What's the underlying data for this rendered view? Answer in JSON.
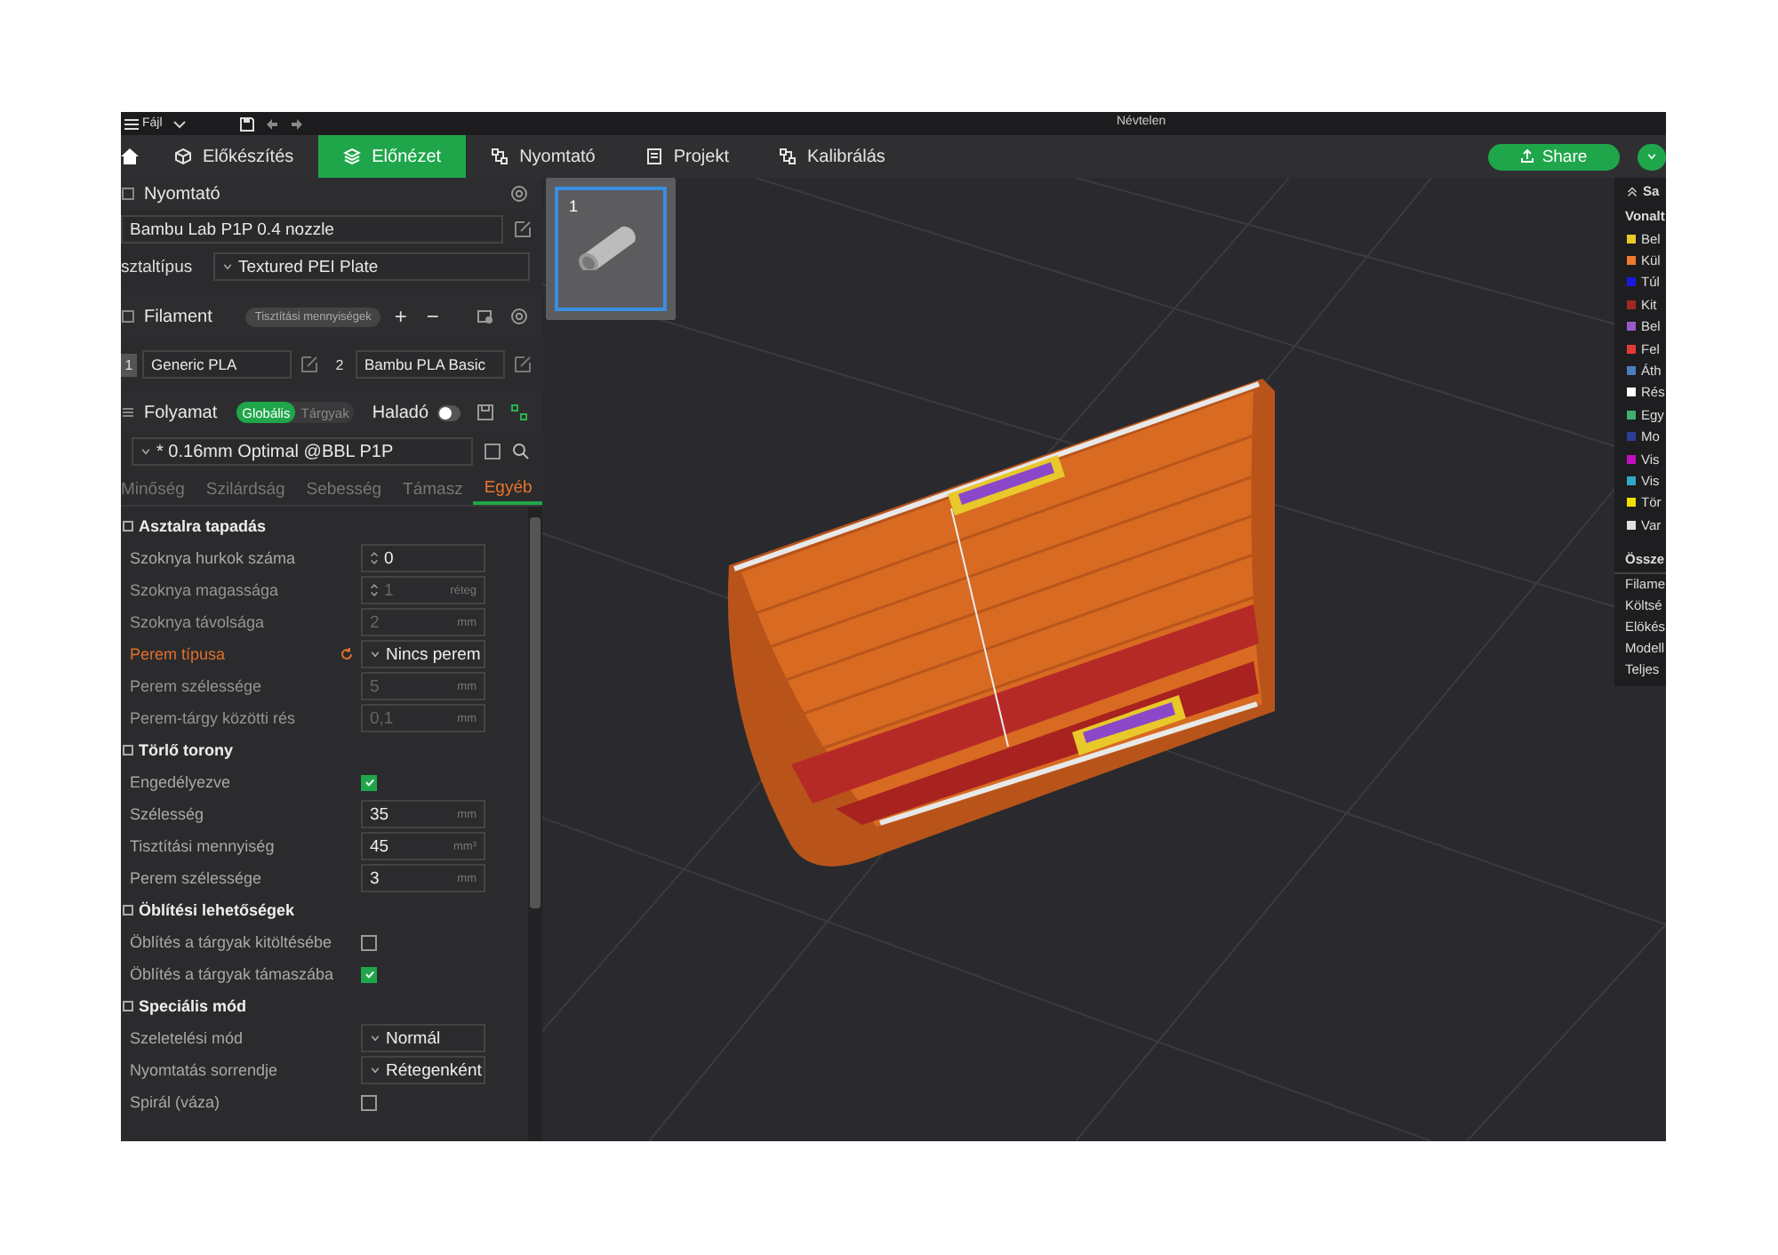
{
  "menu": {
    "file": "Fájl",
    "title": "Névtelen"
  },
  "tabs": [
    {
      "label": "Előkészítés",
      "selected": false
    },
    {
      "label": "Előnézet",
      "selected": true
    },
    {
      "label": "Nyomtató",
      "selected": false
    },
    {
      "label": "Projekt",
      "selected": false
    },
    {
      "label": "Kalibrálás",
      "selected": false
    }
  ],
  "share_button": "Share",
  "printer": {
    "title": "Nyomtató",
    "preset": "Bambu Lab P1P 0.4 nozzle",
    "plate_label": "sztaltípus",
    "plate_value": "Textured PEI Plate"
  },
  "filament": {
    "title": "Filament",
    "badge": "Tisztítási mennyiségek",
    "add": "+",
    "remove": "−",
    "items": [
      {
        "index": "1",
        "name": "Generic PLA"
      },
      {
        "index": "2",
        "name": "Bambu PLA Basic"
      }
    ]
  },
  "process": {
    "title": "Folyamat",
    "scopes": [
      {
        "label": "Globális",
        "selected": true
      },
      {
        "label": "Tárgyak",
        "selected": false
      }
    ],
    "advanced_label": "Haladó",
    "advanced_on": false,
    "preset": "* 0.16mm Optimal @BBL P1P",
    "tabs": [
      {
        "label": "Minőség",
        "selected": false
      },
      {
        "label": "Szilárdság",
        "selected": false
      },
      {
        "label": "Sebesség",
        "selected": false
      },
      {
        "label": "Támasz",
        "selected": false
      },
      {
        "label": "Egyéb",
        "selected": true
      }
    ]
  },
  "sections": [
    {
      "title": "Asztalra tapadás",
      "rows": [
        {
          "label": "Szoknya hurkok száma",
          "kind": "spin",
          "value": "0",
          "disabled": false,
          "modified": false
        },
        {
          "label": "Szoknya magassága",
          "kind": "spin",
          "value": "1",
          "unit": "réteg",
          "disabled": true,
          "modified": false
        },
        {
          "label": "Szoknya távolsága",
          "kind": "text",
          "value": "2",
          "unit": "mm",
          "disabled": true,
          "modified": false
        },
        {
          "label": "Perem típusa",
          "kind": "select",
          "value": "Nincs perem",
          "modified": true
        },
        {
          "label": "Perem szélessége",
          "kind": "text",
          "value": "5",
          "unit": "mm",
          "disabled": true,
          "modified": false
        },
        {
          "label": "Perem-tárgy közötti rés",
          "kind": "text",
          "value": "0,1",
          "unit": "mm",
          "disabled": true,
          "modified": false
        }
      ]
    },
    {
      "title": "Törlő torony",
      "rows": [
        {
          "label": "Engedélyezve",
          "kind": "checkbox",
          "checked": true,
          "modified": false
        },
        {
          "label": "Szélesség",
          "kind": "text",
          "value": "35",
          "unit": "mm",
          "disabled": false,
          "modified": false
        },
        {
          "label": "Tisztítási mennyiség",
          "kind": "text",
          "value": "45",
          "unit": "mm³",
          "disabled": false,
          "modified": false
        },
        {
          "label": "Perem szélessége",
          "kind": "text",
          "value": "3",
          "unit": "mm",
          "disabled": false,
          "modified": false
        }
      ]
    },
    {
      "title": "Öblítési lehetőségek",
      "rows": [
        {
          "label": "Öblítés a tárgyak kitöltésébe",
          "kind": "checkbox",
          "checked": false,
          "modified": false
        },
        {
          "label": "Öblítés a tárgyak támaszába",
          "kind": "checkbox",
          "checked": true,
          "modified": false
        }
      ]
    },
    {
      "title": "Speciális mód",
      "rows": [
        {
          "label": "Szeletelési mód",
          "kind": "select",
          "value": "Normál",
          "modified": false
        },
        {
          "label": "Nyomtatás sorrendje",
          "kind": "select",
          "value": "Rétegenként",
          "modified": false
        },
        {
          "label": "Spirál (váza)",
          "kind": "checkbox",
          "checked": false,
          "modified": false
        }
      ]
    }
  ],
  "plate": {
    "number": "1",
    "selected": true
  },
  "legend": {
    "header": "Sa",
    "title": "Vonalt",
    "items": [
      {
        "label": "Bel",
        "color": "#e8c82a"
      },
      {
        "label": "Kül",
        "color": "#f07a30"
      },
      {
        "label": "Túl",
        "color": "#1a1adf"
      },
      {
        "label": "Kit",
        "color": "#a02a22"
      },
      {
        "label": "Bel",
        "color": "#9a5ac8"
      },
      {
        "label": "Fel",
        "color": "#e03a3a"
      },
      {
        "label": "Áth",
        "color": "#4a7ec0"
      },
      {
        "label": "Rés",
        "color": "#ffffff"
      },
      {
        "label": "Egy",
        "color": "#40b070"
      },
      {
        "label": "Mo",
        "color": "#2a3e98"
      },
      {
        "label": "Vis",
        "color": "#c010c0"
      },
      {
        "label": "Vis",
        "color": "#30a8c8"
      },
      {
        "label": "Tör",
        "color": "#f0e000"
      },
      {
        "label": "Var",
        "color": "#e0e0e0"
      }
    ],
    "summary_title": "Össze",
    "summary": [
      "Filame",
      "Költsé",
      "Elökés",
      "Modell",
      "Teljes"
    ]
  }
}
